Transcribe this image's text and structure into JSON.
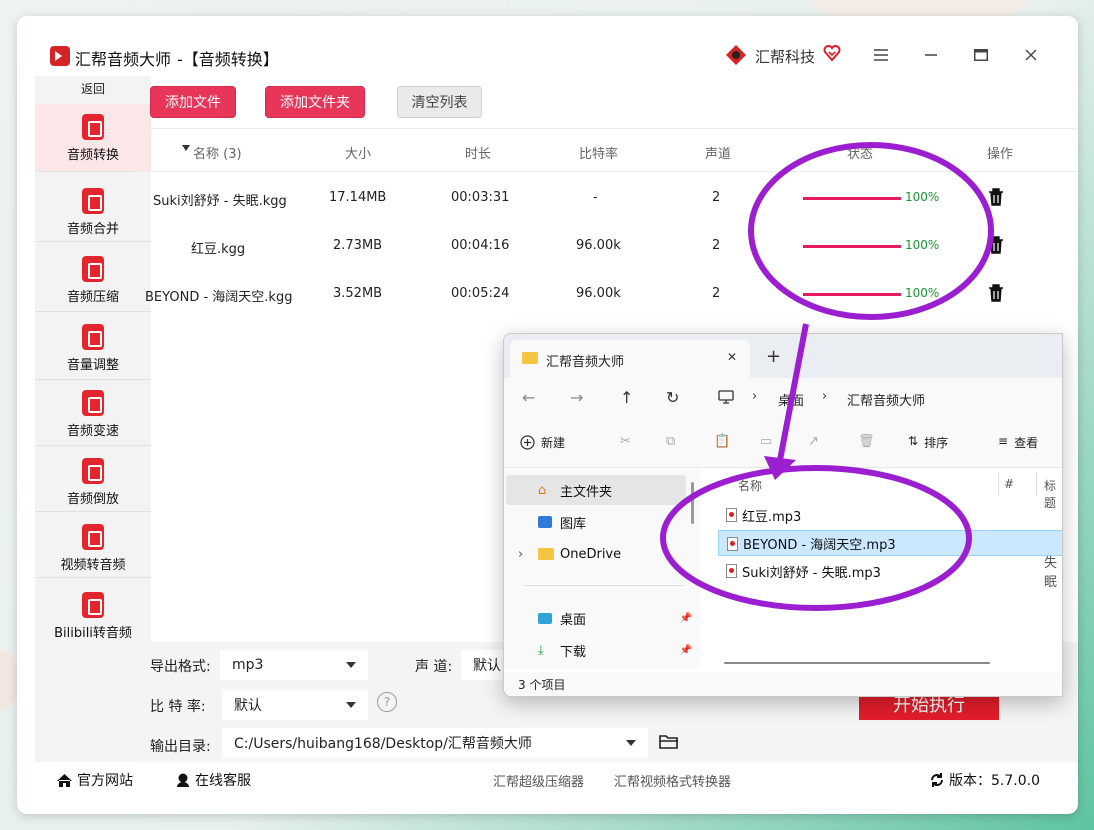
{
  "app": {
    "title": "汇帮音频大师",
    "subtitle": "-【音频转换】",
    "brand": "汇帮科技"
  },
  "sidebar": {
    "back_label": "返回",
    "items": [
      {
        "label": "音频转换",
        "icon": "audio-convert-icon",
        "active": true
      },
      {
        "label": "音频合并",
        "icon": "audio-merge-icon"
      },
      {
        "label": "音频压缩",
        "icon": "audio-compress-icon"
      },
      {
        "label": "音量调整",
        "icon": "volume-icon"
      },
      {
        "label": "音频变速",
        "icon": "microphone-icon"
      },
      {
        "label": "音频倒放",
        "icon": "music-note-icon"
      },
      {
        "label": "视频转音频",
        "icon": "video-icon"
      },
      {
        "label": "Bilibili转音频",
        "icon": "bilibili-icon"
      }
    ]
  },
  "toolbar": {
    "add_file": "添加文件",
    "add_folder": "添加文件夹",
    "clear_list": "清空列表"
  },
  "table": {
    "headers": {
      "name": "名称 (3)",
      "size": "大小",
      "duration": "时长",
      "bitrate": "比特率",
      "channels": "声道",
      "status": "状态",
      "action": "操作"
    },
    "rows": [
      {
        "name": "Suki刘舒妤 - 失眠.kgg",
        "size": "17.14MB",
        "duration": "00:03:31",
        "bitrate": "-",
        "channels": "2",
        "progress": 1.0,
        "status": "100%"
      },
      {
        "name": "红豆.kgg",
        "size": "2.73MB",
        "duration": "00:04:16",
        "bitrate": "96.00k",
        "channels": "2",
        "progress": 1.0,
        "status": "100%"
      },
      {
        "name": "BEYOND - 海阔天空.kgg",
        "size": "3.52MB",
        "duration": "00:05:24",
        "bitrate": "96.00k",
        "channels": "2",
        "progress": 1.0,
        "status": "100%"
      }
    ]
  },
  "settings": {
    "format_label": "导出格式:",
    "format_value": "mp3",
    "channel_label": "声 道:",
    "channel_value": "默认",
    "bitrate_label": "比 特 率:",
    "bitrate_value": "默认",
    "help": "?",
    "output_label": "输出目录:",
    "output_value": "C:/Users/huibang168/Desktop/汇帮音频大师",
    "start_button": "开始执行"
  },
  "footer": {
    "website": "官方网站",
    "support": "在线客服",
    "link1": "汇帮超级压缩器",
    "link2": "汇帮视频格式转换器",
    "version": "版本：5.7.0.0"
  },
  "explorer": {
    "tab_title": "汇帮音频大师",
    "tab_close": "✕",
    "tab_new": "+",
    "breadcrumb": [
      "桌面",
      "汇帮音频大师"
    ],
    "new_label": "新建",
    "sort_label": "排序",
    "view_label": "查看",
    "nav_items": [
      {
        "label": "主文件夹",
        "selected": true
      },
      {
        "label": "图库"
      },
      {
        "label": "OneDrive"
      },
      {
        "label": "桌面"
      },
      {
        "label": "下载"
      }
    ],
    "columns": {
      "name": "名称",
      "num": "#",
      "title": "标题"
    },
    "files": [
      {
        "name": "红豆.mp3",
        "extra": ""
      },
      {
        "name": "BEYOND - 海阔天空.mp3",
        "extra": "",
        "selected": true
      },
      {
        "name": "Suki刘舒妤 - 失眠.mp3",
        "extra": "失眠"
      }
    ],
    "status": "3 个项目"
  },
  "colors": {
    "accent": "#e8365a",
    "progress": "#e21d5c",
    "success": "#169b2e",
    "annotation": "#9b1fd0"
  }
}
